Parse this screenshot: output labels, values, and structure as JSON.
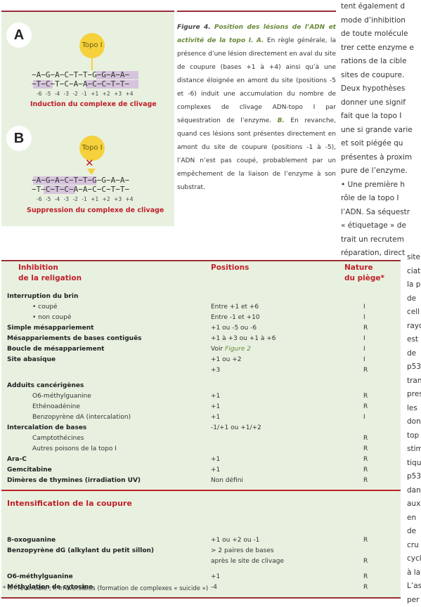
{
  "figure": {
    "panel_a": "A",
    "panel_b": "B",
    "topo_label": "Topo I",
    "a_top": "−A−G−A−C−T−T−G−G−A−A−",
    "a_bottom": "−T−C−T−C−A−A−C−C−T−T−",
    "b_top": "−A−G−A−C−T−T−G−G−A−A−",
    "b_bottom": "−T−C−T−C−A−A−C−C−T−T−",
    "positions": "-6 -5 -4 -3 -2 -1 +1 +2 +3 +4",
    "a_caption": "Induction du complexe de clivage",
    "b_caption": "Suppression du complexe de clivage",
    "block_icon": "x-mark-icon"
  },
  "caption": {
    "figure_label": "Figure 4.",
    "title": "Position des lésions de l’ADN et activité de la topo I.",
    "a_label": "A.",
    "a_text": "En règle générale, la présence d’une lésion directement en aval du site de coupure (bases +1 à +4) ainsi qu’à une distance éloignée en amont du site (positions -5 et -6) induit une accumulation du nombre de complexes de clivage ADN-topo I par séquestration de l’enzyme.",
    "b_label": "B.",
    "b_text": "En revanche, quand ces lésions sont présentes directement en amont du site de coupure (positions -1 à -5), l’ADN n’est pas coupé, probablement par un empêchement de la liaison de l’enzyme à son substrat."
  },
  "right_text": [
    "tent également d",
    "mode d’inhibition",
    "de toute molécule",
    "trer cette enzyme e",
    "rations de la cible",
    "sites de coupure.",
    "Deux hypothèses",
    "donner une signif",
    "fait que la topo I",
    "une si grande varie",
    "et soit piégée qu",
    "présentes à proxim",
    "pure de l’enzyme.",
    "• Une première h",
    "rôle de la topo I",
    "l’ADN. Sa séquestr",
    "« étiquetage » de",
    "trait un recrutem",
    "réparation, direct"
  ],
  "narrow_text": [
    "site",
    "ciat",
    "la p",
    "de",
    "cell",
    "rayo",
    "est",
    "de",
    "p53",
    "tran",
    "pres",
    "les",
    "don",
    "top",
    "stim",
    "tiqu",
    "p53",
    "dan",
    "aux",
    "en",
    "de",
    "cru",
    "cycl",
    "à la",
    "L’as",
    "per"
  ],
  "table": {
    "header": {
      "col1_line1": "Inhibition",
      "col1_line2": "de la religation",
      "col2": "Positions",
      "col3_line1": "Nature",
      "col3_line2": "du piège*"
    },
    "rows": [
      {
        "name": "Interruption du brin",
        "pos": "",
        "nat": "",
        "bold": true
      },
      {
        "name": "• coupé",
        "pos": "Entre +1 et +6",
        "nat": "I",
        "indent": true
      },
      {
        "name": "• non coupé",
        "pos": "Entre -1 et +10",
        "nat": "I",
        "indent": true
      },
      {
        "name": "Simple mésappariement",
        "pos": "+1 ou -5 ou -6",
        "nat": "R",
        "bold": true
      },
      {
        "name": "Mésappariements de bases contiguës",
        "pos": "+1 à +3 ou +1 à +6",
        "nat": "I",
        "bold": true
      },
      {
        "name": "Boucle de mésappariement",
        "pos": "Voir Figure 2",
        "nat": "I",
        "bold": true
      },
      {
        "name": "Site abasique",
        "pos": "+1 ou +2",
        "nat": "I",
        "bold": true
      },
      {
        "name": "",
        "pos": "+3",
        "nat": "R"
      },
      {
        "name": "Adduits cancérigènes",
        "pos": "",
        "nat": "",
        "bold": true,
        "gap": true
      },
      {
        "name": "O6-méthylguanine",
        "pos": "+1",
        "nat": "R",
        "indent": true
      },
      {
        "name": "Ethénoadénine",
        "pos": "+1",
        "nat": "R",
        "indent": true
      },
      {
        "name": "Benzopyrène dA (intercalation)",
        "pos": "+1",
        "nat": "I",
        "indent": true
      },
      {
        "name": "Intercalation de bases",
        "pos": "-1/+1 ou +1/+2",
        "nat": "",
        "bold": true
      },
      {
        "name": "Camptothécines",
        "pos": "",
        "nat": "R",
        "indent": true
      },
      {
        "name": "Autres poisons de la topo I",
        "pos": "",
        "nat": "R",
        "indent": true
      },
      {
        "name": "Ara-C",
        "pos": "+1",
        "nat": "R",
        "bold": true
      },
      {
        "name": "Gemcitabine",
        "pos": "+1",
        "nat": "R",
        "bold": true
      },
      {
        "name": "Dimères de thymines (irradiation UV)",
        "pos": "Non défini",
        "nat": "R",
        "bold": true
      }
    ],
    "section2_title": "Intensification de la coupure",
    "rows2": [
      {
        "name": "8-oxoguanine",
        "pos": "+1 ou +2 ou -1",
        "nat": "R",
        "bold": true
      },
      {
        "name": "Benzopyrène dG (alkylant du petit sillon)",
        "pos": "> 2 paires de bases",
        "nat": "",
        "bold": true
      },
      {
        "name": "",
        "pos": "après le site de clivage",
        "nat": "R"
      },
      {
        "name": "O6-méthylguanine",
        "pos": "+1",
        "nat": "R",
        "bold": true,
        "gap": true
      },
      {
        "name": "Méthylation de cytosine",
        "pos": "-4",
        "nat": "R",
        "bold": true
      }
    ],
    "footnote": "* R : réversible ; I: irréversibles (formation de complexes « suicide »)"
  }
}
